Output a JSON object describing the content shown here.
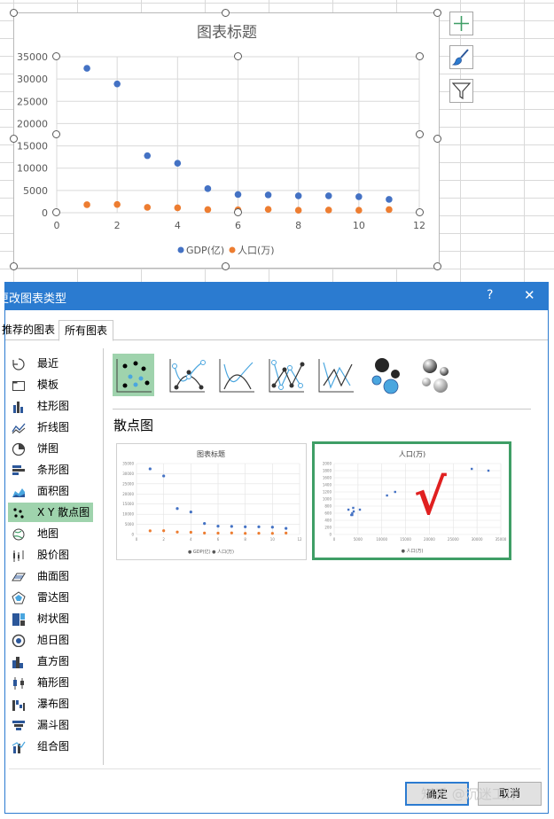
{
  "chart": {
    "title": "图表标题",
    "legend": [
      {
        "name": "GDP(亿)",
        "color": "#4472c4"
      },
      {
        "name": "人口(万)",
        "color": "#ed7d31"
      }
    ]
  },
  "side_buttons": [
    {
      "icon": "plus-icon"
    },
    {
      "icon": "brush-icon"
    },
    {
      "icon": "filter-icon"
    }
  ],
  "dialog": {
    "title": "更改图表类型",
    "help": "?",
    "close": "✕",
    "tabs": [
      "推荐的图表",
      "所有图表"
    ],
    "categories": [
      "最近",
      "模板",
      "柱形图",
      "折线图",
      "饼图",
      "条形图",
      "面积图",
      "X Y 散点图",
      "地图",
      "股价图",
      "曲面图",
      "雷达图",
      "树状图",
      "旭日图",
      "直方图",
      "箱形图",
      "瀑布图",
      "漏斗图",
      "组合图"
    ],
    "selected_category": "X Y 散点图",
    "subtype_title": "散点图",
    "preview1_title": "图表标题",
    "preview1_legend": "● GDP(亿)  ● 人口(万)",
    "preview2_title": "人口(万)",
    "preview2_legend": "● 人口(万)",
    "ok": "确定",
    "cancel": "取消",
    "check_mark": "√"
  },
  "watermark": "知乎 @沉迷工作",
  "chart_data": [
    {
      "type": "scatter",
      "title": "图表标题",
      "xlim": [
        0,
        12
      ],
      "ylim": [
        0,
        35000
      ],
      "x_ticks": [
        0,
        2,
        4,
        6,
        8,
        10,
        12
      ],
      "y_ticks": [
        0,
        5000,
        10000,
        15000,
        20000,
        25000,
        30000,
        35000
      ],
      "grid": true,
      "legend": "bottom",
      "series": [
        {
          "name": "GDP(亿)",
          "color": "#4472c4",
          "x": [
            1,
            2,
            3,
            4,
            5,
            6,
            7,
            8,
            9,
            10,
            11
          ],
          "y": [
            32400,
            28900,
            12800,
            11100,
            5400,
            4100,
            4000,
            3800,
            3800,
            3600,
            3000
          ]
        },
        {
          "name": "人口(万)",
          "color": "#ed7d31",
          "x": [
            1,
            2,
            3,
            4,
            5,
            6,
            7,
            8,
            9,
            10,
            11
          ],
          "y": [
            1800,
            1850,
            1200,
            1100,
            700,
            650,
            750,
            550,
            600,
            550,
            700
          ]
        }
      ]
    }
  ]
}
